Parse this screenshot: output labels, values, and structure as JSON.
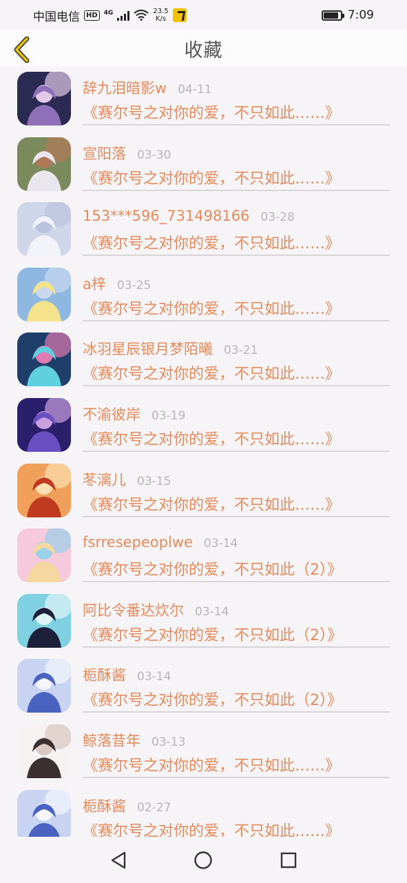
{
  "status": {
    "carrier": "中国电信",
    "hd": "HD",
    "network": "4G",
    "speed_value": "23.5",
    "speed_unit": "K/s",
    "time": "7:09"
  },
  "header": {
    "title": "收藏",
    "back_icon": "chevron-left-icon"
  },
  "favorites": [
    {
      "name": "辞九泪暗影w",
      "date": "04-11",
      "title": "《赛尔号之对你的爱，不只如此……》",
      "avatar": [
        "#2b2a52",
        "#8f6fb8",
        "#e2c9e8"
      ]
    },
    {
      "name": "宣阳落",
      "date": "03-30",
      "title": "《赛尔号之对你的爱，不只如此……》",
      "avatar": [
        "#7b8a5c",
        "#e9e6ee",
        "#b07a5a"
      ]
    },
    {
      "name": "153***596_731498166",
      "date": "03-28",
      "title": "《赛尔号之对你的爱，不只如此……》",
      "avatar": [
        "#cfd6ea",
        "#f2f3f8",
        "#b9c3dd"
      ]
    },
    {
      "name": "a梓",
      "date": "03-25",
      "title": "《赛尔号之对你的爱，不只如此……》",
      "avatar": [
        "#8fb8e0",
        "#f4e38a",
        "#c8d9ef"
      ]
    },
    {
      "name": "冰羽星辰银月梦陌曦",
      "date": "03-21",
      "title": "《赛尔号之对你的爱，不只如此……》",
      "avatar": [
        "#1f3f6a",
        "#5fd0e0",
        "#e07ab0"
      ]
    },
    {
      "name": "不渝彼岸",
      "date": "03-19",
      "title": "《赛尔号之对你的爱，不只如此……》",
      "avatar": [
        "#2a1f6a",
        "#6a4fc0",
        "#c9a0e0"
      ]
    },
    {
      "name": "苳漓儿",
      "date": "03-15",
      "title": "《赛尔号之对你的爱，不只如此……》",
      "avatar": [
        "#f0a05a",
        "#c03a20",
        "#fbe0b0"
      ]
    },
    {
      "name": "fsrresepeoplwe",
      "date": "03-14",
      "title": "《赛尔号之对你的爱，不只如此（2）》",
      "avatar": [
        "#f7c9dc",
        "#f4d8a0",
        "#9ad0e8"
      ]
    },
    {
      "name": "阿比令番达炊尔",
      "date": "03-14",
      "title": "《赛尔号之对你的爱，不只如此（2）》",
      "avatar": [
        "#7fd0e0",
        "#1c1f3a",
        "#e0f4f8"
      ]
    },
    {
      "name": "栀酥酱",
      "date": "03-14",
      "title": "《赛尔号之对你的爱，不只如此（2）》",
      "avatar": [
        "#c8d4f2",
        "#4a62c0",
        "#f4f6fc"
      ]
    },
    {
      "name": "鲸落昔年",
      "date": "03-13",
      "title": "《赛尔号之对你的爱，不只如此……》",
      "avatar": [
        "#f6f2f2",
        "#3a3030",
        "#d9c8c0"
      ]
    },
    {
      "name": "栀酥酱",
      "date": "02-27",
      "title": "《赛尔号之对你的爱，不只如此……》",
      "avatar": [
        "#c8d4f2",
        "#4a62c0",
        "#f4f6fc"
      ]
    }
  ],
  "navbar": {
    "back_icon": "triangle-back-icon",
    "home_icon": "circle-home-icon",
    "recents_icon": "square-recents-icon"
  },
  "colors": {
    "accent": "#e58a5a",
    "date": "#b8b3b6",
    "divider": "#d9d5d9",
    "back_chevron": "#e6c200"
  }
}
